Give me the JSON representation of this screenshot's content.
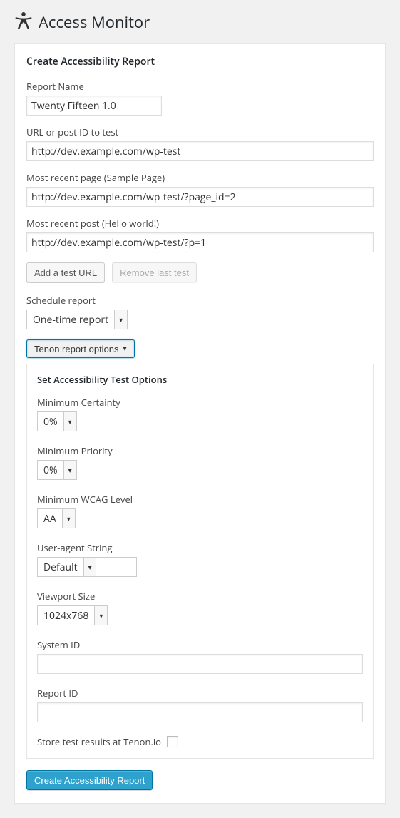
{
  "page_title": "Access Monitor",
  "form_title": "Create Accessibility Report",
  "report_name": {
    "label": "Report Name",
    "value": "Twenty Fifteen 1.0"
  },
  "url_to_test": {
    "label": "URL or post ID to test",
    "value": "http://dev.example.com/wp-test"
  },
  "recent_page": {
    "label": "Most recent page (Sample Page)",
    "value": "http://dev.example.com/wp-test/?page_id=2"
  },
  "recent_post": {
    "label": "Most recent post (Hello world!)",
    "value": "http://dev.example.com/wp-test/?p=1"
  },
  "buttons": {
    "add_url": "Add a test URL",
    "remove_last": "Remove last test",
    "options_toggle": "Tenon report options",
    "submit": "Create Accessibility Report"
  },
  "schedule": {
    "label": "Schedule report",
    "value": "One-time report"
  },
  "options_heading": "Set Accessibility Test Options",
  "options": {
    "certainty": {
      "label": "Minimum Certainty",
      "value": "0%"
    },
    "priority": {
      "label": "Minimum Priority",
      "value": "0%"
    },
    "wcag": {
      "label": "Minimum WCAG Level",
      "value": "AA"
    },
    "ua": {
      "label": "User-agent String",
      "value": "Default"
    },
    "viewport": {
      "label": "Viewport Size",
      "value": "1024x768"
    },
    "system_id": {
      "label": "System ID",
      "value": ""
    },
    "report_id": {
      "label": "Report ID",
      "value": ""
    },
    "store": {
      "label": "Store test results at Tenon.io",
      "checked": false
    }
  }
}
